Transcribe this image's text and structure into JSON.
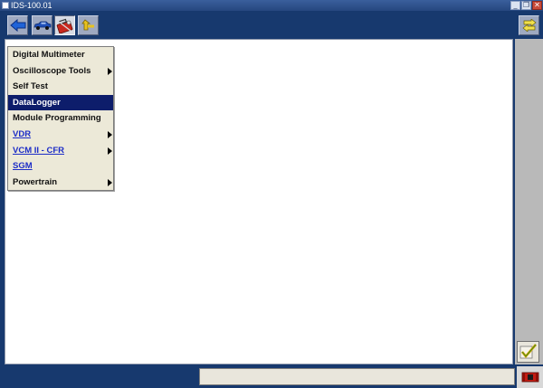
{
  "window": {
    "title": "IDS-100.01",
    "minimize_glyph": "_",
    "maximize_glyph": "❐",
    "close_glyph": "✕"
  },
  "toolbar": {
    "buttons": [
      {
        "icon": "back-arrow-icon",
        "active": false
      },
      {
        "icon": "vehicle-icon",
        "active": false
      },
      {
        "icon": "toolbox-icon",
        "active": true
      },
      {
        "icon": "recent-arrow-icon",
        "active": false
      }
    ],
    "right_button_icon": "swap-arrows-icon"
  },
  "menu": {
    "items": [
      {
        "label": "Digital Multimeter",
        "submenu": false,
        "link": false,
        "selected": false
      },
      {
        "label": "Oscilloscope Tools",
        "submenu": true,
        "link": false,
        "selected": false
      },
      {
        "label": "Self Test",
        "submenu": false,
        "link": false,
        "selected": false
      },
      {
        "label": "DataLogger",
        "submenu": false,
        "link": false,
        "selected": true
      },
      {
        "label": "Module Programming",
        "submenu": false,
        "link": false,
        "selected": false
      },
      {
        "label": "VDR",
        "submenu": true,
        "link": true,
        "selected": false
      },
      {
        "label": "VCM II - CFR",
        "submenu": true,
        "link": true,
        "selected": false
      },
      {
        "label": "SGM",
        "submenu": false,
        "link": true,
        "selected": false
      },
      {
        "label": "Powertrain",
        "submenu": true,
        "link": false,
        "selected": false
      }
    ]
  },
  "status": {
    "message": "",
    "check_icon": "checkmark-icon",
    "vcm_icon": "vcm-status-icon"
  },
  "colors": {
    "app_background": "#17396e",
    "menu_selected": "#0d1d6b",
    "link_text": "#1d2dc7"
  }
}
